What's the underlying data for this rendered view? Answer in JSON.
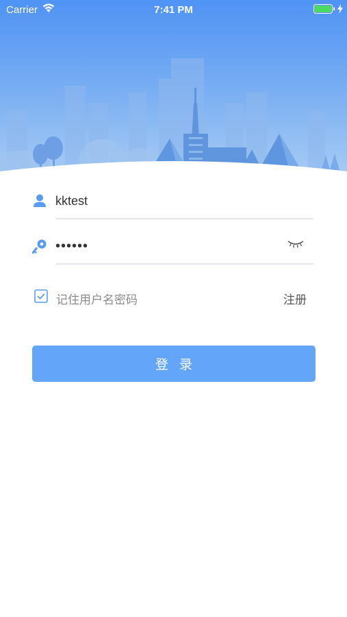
{
  "status_bar": {
    "carrier": "Carrier",
    "time": "7:41 PM",
    "battery_color": "#4cd964"
  },
  "login_form": {
    "username_value": "kktest",
    "password_value": "••••••",
    "remember_label": "记住用户名密码",
    "remember_checked": true,
    "register_label": "注册",
    "login_button_label": "登录"
  },
  "icons": {
    "username": "user-icon",
    "password": "key-icon",
    "visibility": "eye-closed-icon",
    "remember": "checkbox-checked-icon"
  },
  "colors": {
    "accent": "#62a5f9",
    "icon_blue": "#5a9cf2",
    "header_top": "#4f93f5",
    "header_bottom": "#a9cdf4"
  }
}
